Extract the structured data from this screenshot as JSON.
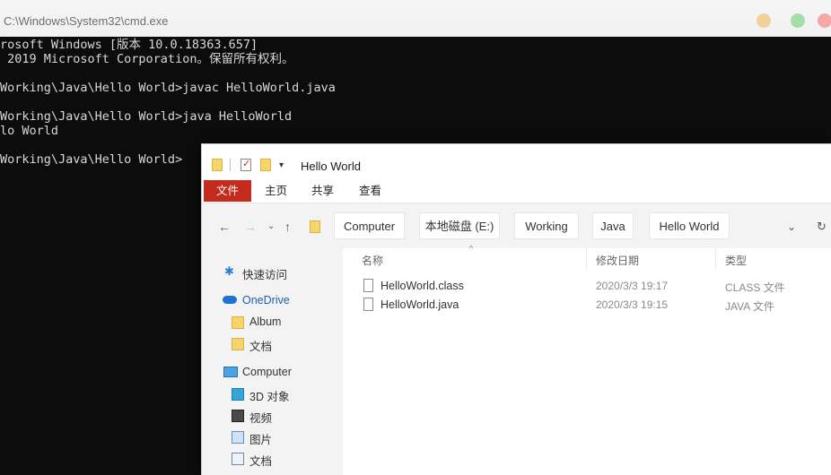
{
  "cmd": {
    "title": "C:\\Windows\\System32\\cmd.exe",
    "lines": [
      "rosoft Windows [版本 10.0.18363.657]",
      " 2019 Microsoft Corporation。保留所有权利。",
      "",
      "Working\\Java\\Hello World>javac HelloWorld.java",
      "",
      "Working\\Java\\Hello World>java HelloWorld",
      "lo World",
      "",
      "Working\\Java\\Hello World>"
    ]
  },
  "explorer": {
    "title": "Hello World",
    "ribbon_tabs": [
      "文件",
      "主页",
      "共享",
      "查看"
    ],
    "breadcrumbs": [
      "Computer",
      "本地磁盘 (E:)",
      "Working",
      "Java",
      "Hello World"
    ],
    "sidebar": {
      "quick_access": "快速访问",
      "onedrive": "OneDrive",
      "album": "Album",
      "documents": "文档",
      "computer": "Computer",
      "objects3d": "3D 对象",
      "videos": "视频",
      "pictures": "图片",
      "documents2": "文档"
    },
    "columns": {
      "name": "名称",
      "modified": "修改日期",
      "type": "类型"
    },
    "files": [
      {
        "name": "HelloWorld.class",
        "modified": "2020/3/3 19:17",
        "type": "CLASS 文件"
      },
      {
        "name": "HelloWorld.java",
        "modified": "2020/3/3 19:15",
        "type": "JAVA 文件"
      }
    ]
  },
  "colors": {
    "console_bg": "#0c0c0c",
    "console_text": "#d8d8d8",
    "ribbon_active": "#c42b1c",
    "folder": "#f8d568"
  }
}
